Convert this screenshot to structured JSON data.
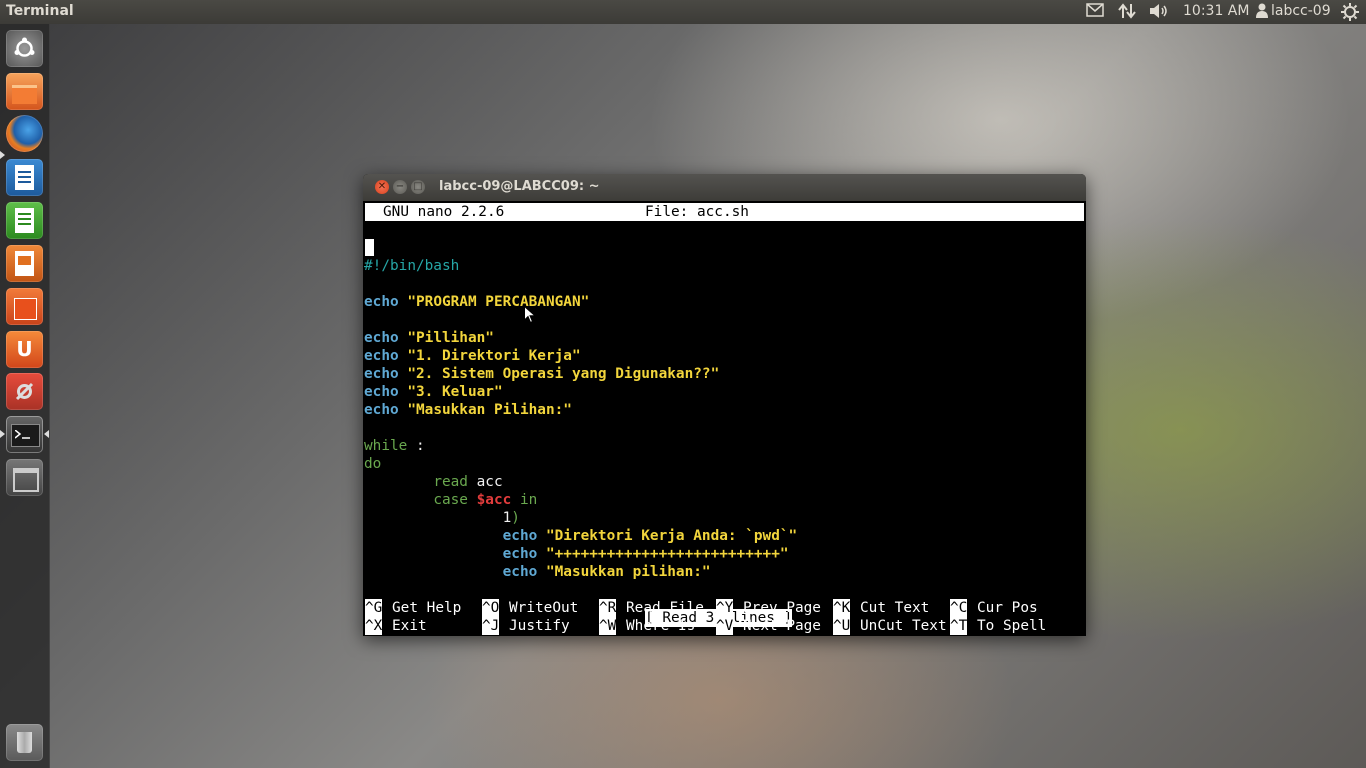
{
  "panel": {
    "app_title": "Terminal",
    "clock": "10:31 AM",
    "user": "labcc-09",
    "icons": [
      "mail-icon",
      "network-icon",
      "volume-icon",
      "user-icon",
      "gear-icon"
    ]
  },
  "launcher": {
    "items": [
      "dash-home",
      "files",
      "firefox",
      "libreoffice-writer",
      "libreoffice-calc",
      "libreoffice-impress",
      "software-center",
      "ubuntu-one",
      "system-settings",
      "terminal",
      "workspace-switcher",
      "trash"
    ]
  },
  "window": {
    "title": "labcc-09@LABCC09: ~"
  },
  "nano": {
    "version": "GNU nano 2.2.6",
    "file": "File: acc.sh",
    "status": "[ Read 31 lines ]",
    "shortcuts_row1": [
      {
        "key": "^G",
        "label": "Get Help"
      },
      {
        "key": "^O",
        "label": "WriteOut"
      },
      {
        "key": "^R",
        "label": "Read File"
      },
      {
        "key": "^Y",
        "label": "Prev Page"
      },
      {
        "key": "^K",
        "label": "Cut Text"
      },
      {
        "key": "^C",
        "label": "Cur Pos"
      }
    ],
    "shortcuts_row2": [
      {
        "key": "^X",
        "label": "Exit"
      },
      {
        "key": "^J",
        "label": "Justify"
      },
      {
        "key": "^W",
        "label": "Where Is"
      },
      {
        "key": "^V",
        "label": "Next Page"
      },
      {
        "key": "^U",
        "label": "UnCut Text"
      },
      {
        "key": "^T",
        "label": "To Spell"
      }
    ]
  },
  "code": {
    "shebang": "#!/bin/bash",
    "echo": "echo",
    "l1_str": "\"PROGRAM PERCABANGAN\"",
    "l2_str": "\"Pillihan\"",
    "l3_str": "\"1. Direktori Kerja\"",
    "l4_str": "\"2. Sistem Operasi yang Digunakan??\"",
    "l5_str": "\"3. Keluar\"",
    "l6_str": "\"Masukkan Pilihan:\"",
    "while": "while",
    "colon": ":",
    "do": "do",
    "read": "read",
    "acc": "acc",
    "case": "case",
    "var_acc": "$acc",
    "in": "in",
    "opt1": "1",
    "paren": ")",
    "l7_str": "\"Direktori Kerja Anda: `pwd`\"",
    "l8_str": "\"++++++++++++++++++++++++++\"",
    "l9_str": "\"Masukkan pilihan:\""
  }
}
